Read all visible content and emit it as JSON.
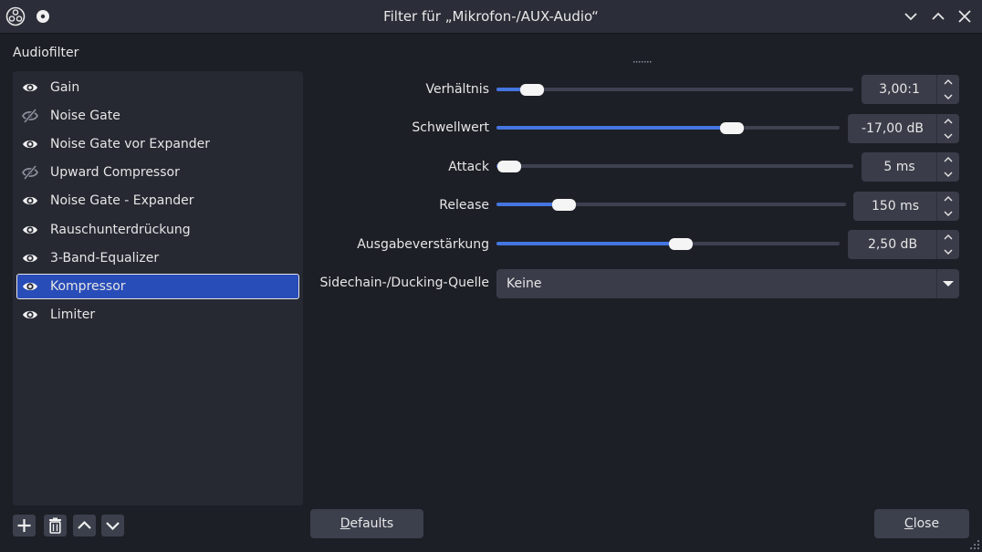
{
  "window": {
    "title": "Filter für „Mikrofon-/AUX-Audio“",
    "icons": [
      "obs-logo-icon",
      "pin-icon",
      "minimize-icon",
      "maximize-icon",
      "close-icon"
    ]
  },
  "sidebar": {
    "label": "Audiofilter",
    "items": [
      {
        "label": "Gain",
        "visible": true
      },
      {
        "label": "Noise Gate",
        "visible": false
      },
      {
        "label": "Noise Gate vor Expander",
        "visible": true
      },
      {
        "label": "Upward Compressor",
        "visible": false
      },
      {
        "label": "Noise Gate - Expander",
        "visible": true
      },
      {
        "label": "Rauschunterdrückung",
        "visible": true
      },
      {
        "label": "3-Band-Equalizer",
        "visible": true
      },
      {
        "label": "Kompressor",
        "visible": true,
        "selected": true
      },
      {
        "label": "Limiter",
        "visible": true
      }
    ],
    "tools": [
      "add-icon",
      "trash-icon",
      "move-up-icon",
      "move-down-icon"
    ]
  },
  "properties": {
    "ratio": {
      "label": "Verhältnis",
      "value": "3,00:1",
      "level": 0.07
    },
    "threshold": {
      "label": "Schwellwert",
      "value": "-17,00 dB",
      "level": 0.7
    },
    "attack": {
      "label": "Attack",
      "value": "5 ms",
      "level": 0.0
    },
    "release": {
      "label": "Release",
      "value": "150 ms",
      "level": 0.17
    },
    "output_gain": {
      "label": "Ausgabeverstärkung",
      "value": "2,50 dB",
      "level": 0.54
    },
    "sidechain": {
      "label": "Sidechain-/Ducking-Quelle",
      "value": "Keine"
    }
  },
  "buttons": {
    "defaults": {
      "mnemonic": "D",
      "rest": "efaults"
    },
    "close": {
      "mnemonic": "C",
      "rest": "lose"
    }
  },
  "colors": {
    "accent": "#4475e0",
    "selection": "#284cb8",
    "background": "#1d1f26"
  }
}
